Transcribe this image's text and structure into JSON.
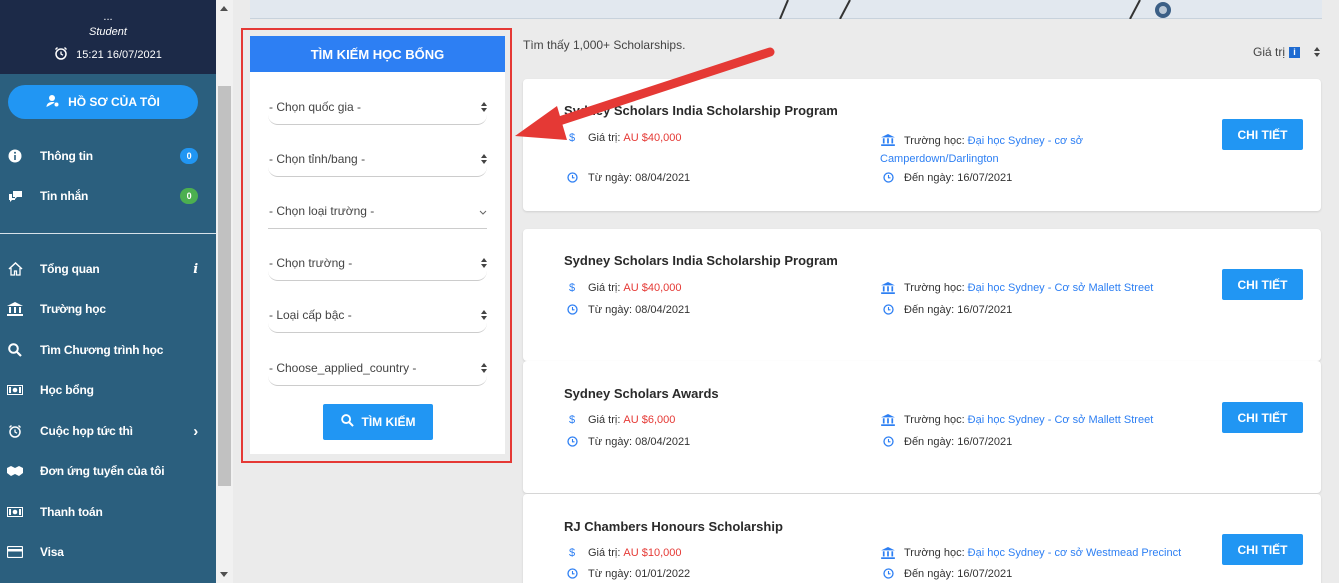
{
  "sidebar": {
    "top_dots": "...",
    "role": "Student",
    "time": "15:21 16/07/2021",
    "profile_button": "HỒ SƠ CỦA TÔI",
    "items": [
      {
        "label": "Thông tin",
        "icon": "info-icon",
        "badge": "0",
        "badge_color": "#2196f3"
      },
      {
        "label": "Tin nhắn",
        "icon": "chat-icon",
        "badge": "0",
        "badge_color": "#4caf50"
      },
      {
        "label": "Tổng quan",
        "icon": "home-icon",
        "extra": "i"
      },
      {
        "label": "Trường học",
        "icon": "building-icon"
      },
      {
        "label": "Tìm Chương trình học",
        "icon": "search-icon"
      },
      {
        "label": "Học bổng",
        "icon": "money-icon"
      },
      {
        "label": "Cuộc họp tức thì",
        "icon": "alarm-icon",
        "extra": "›"
      },
      {
        "label": "Đơn ứng tuyển của tôi",
        "icon": "hands-icon"
      },
      {
        "label": "Thanh toán",
        "icon": "cash-icon"
      },
      {
        "label": "Visa",
        "icon": "card-icon"
      }
    ]
  },
  "search_panel": {
    "title": "TÌM KIẾM HỌC BỔNG",
    "selects": [
      "- Chọn quốc gia -",
      "- Chọn tỉnh/bang -",
      "- Chọn loại trường -",
      "- Chọn trường -",
      "- Loại cấp bậc -",
      "- Choose_applied_country -"
    ],
    "search_button": "TÌM KIẾM"
  },
  "results": {
    "count_text": "Tìm thấy 1,000+ Scholarships.",
    "sort_label": "Giá trị",
    "sort_badge": "i"
  },
  "labels": {
    "value": "Giá trị:",
    "school": "Trường học:",
    "from": "Từ ngày:",
    "to": "Đến ngày:",
    "detail": "CHI TIẾT"
  },
  "scholarships": [
    {
      "title": "Sydney Scholars India Scholarship Program",
      "value": "AU $40,000",
      "school": "Đại học Sydney - cơ sở Camperdown/Darlington",
      "from": "08/04/2021",
      "to": "16/07/2021"
    },
    {
      "title": "Sydney Scholars India Scholarship Program",
      "value": "AU $40,000",
      "school": "Đại học Sydney - Cơ sở Mallett Street",
      "from": "08/04/2021",
      "to": "16/07/2021"
    },
    {
      "title": "Sydney Scholars Awards",
      "value": "AU $6,000",
      "school": "Đại học Sydney - Cơ sở Mallett Street",
      "from": "08/04/2021",
      "to": "16/07/2021"
    },
    {
      "title": "RJ Chambers Honours Scholarship",
      "value": "AU $10,000",
      "school": "Đại học Sydney - cơ sở Westmead Precinct",
      "from": "01/01/2022",
      "to": "16/07/2021"
    }
  ],
  "colors": {
    "sidebar": "#2b5f7e",
    "sidebar_top": "#1c2a48",
    "primary": "#2196f3",
    "price": "#e53935",
    "highlight": "#e53935"
  }
}
